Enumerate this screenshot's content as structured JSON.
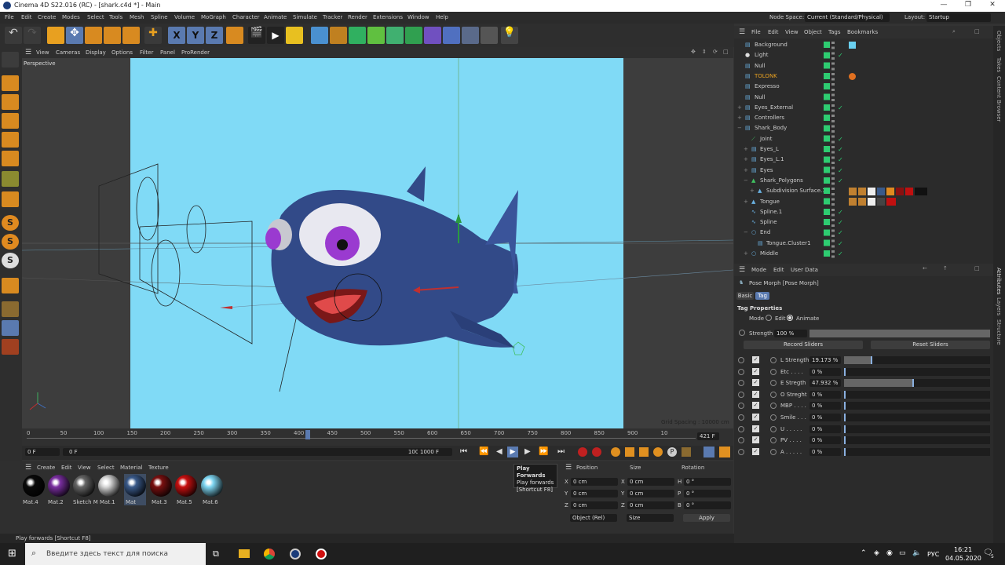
{
  "window": {
    "title": "Cinema 4D S22.016 (RC) - [shark.c4d *] - Main"
  },
  "menubar": {
    "items": [
      "File",
      "Edit",
      "Create",
      "Modes",
      "Select",
      "Tools",
      "Mesh",
      "Spline",
      "Volume",
      "MoGraph",
      "Character",
      "Animate",
      "Simulate",
      "Tracker",
      "Render",
      "Extensions",
      "Window",
      "Help"
    ],
    "node_space_label": "Node Space:",
    "node_space_value": "Current (Standard/Physical)",
    "layout_label": "Layout:",
    "layout_value": "Startup"
  },
  "viewport": {
    "menu": [
      "View",
      "Cameras",
      "Display",
      "Options",
      "Filter",
      "Panel",
      "ProRender"
    ],
    "name": "Perspective",
    "grid_spacing": "Grid Spacing : 10000 cm"
  },
  "timeline": {
    "ticks": [
      "0",
      "50",
      "100",
      "150",
      "200",
      "250",
      "300",
      "350",
      "400",
      "450",
      "500",
      "550",
      "600",
      "650",
      "700",
      "750",
      "800",
      "850",
      "900",
      "10"
    ],
    "current_frame_end": "421 F",
    "start": "0 F",
    "start2": "0 F",
    "end": "1000 F",
    "end2": "1000 F"
  },
  "tooltip": {
    "title": "Play Forwards",
    "line1": "Play forwards",
    "line2": "[Shortcut F8]"
  },
  "materials": {
    "menu": [
      "Create",
      "Edit",
      "View",
      "Select",
      "Material",
      "Texture"
    ],
    "items": [
      {
        "name": "Mat.4",
        "color": "#0a0a0a"
      },
      {
        "name": "Mat.2",
        "color": "#7a2fa0"
      },
      {
        "name": "Sketch M",
        "color": "#666666"
      },
      {
        "name": "Mat.1",
        "color": "#d8d8d8"
      },
      {
        "name": "Mat",
        "color": "#3a5a8a"
      },
      {
        "name": "Mat.3",
        "color": "#7a1010"
      },
      {
        "name": "Mat.5",
        "color": "#c81010"
      },
      {
        "name": "Mat.6",
        "color": "#7fd6f2"
      }
    ]
  },
  "coords": {
    "headers": [
      "Position",
      "Size",
      "Rotation"
    ],
    "rows": [
      {
        "axis": "X",
        "pos": "0 cm",
        "size_axis": "X",
        "size": "0 cm",
        "rot_axis": "H",
        "rot": "0 °"
      },
      {
        "axis": "Y",
        "pos": "0 cm",
        "size_axis": "Y",
        "size": "0 cm",
        "rot_axis": "P",
        "rot": "0 °"
      },
      {
        "axis": "Z",
        "pos": "0 cm",
        "size_axis": "Z",
        "size": "0 cm",
        "rot_axis": "B",
        "rot": "0 °"
      }
    ],
    "mode": "Object (Rel)",
    "size_mode": "Size",
    "apply": "Apply"
  },
  "status": "Play forwards [Shortcut F8]",
  "objmgr": {
    "menu": [
      "File",
      "Edit",
      "View",
      "Object",
      "Tags",
      "Bookmarks"
    ],
    "objects": [
      {
        "name": "Background",
        "indent": 0
      },
      {
        "name": "Light",
        "indent": 0
      },
      {
        "name": "Null",
        "indent": 0
      },
      {
        "name": "TOLONK",
        "indent": 0,
        "orange": true
      },
      {
        "name": "Expresso",
        "indent": 0
      },
      {
        "name": "Null",
        "indent": 0
      },
      {
        "name": "Eyes_External",
        "indent": 0
      },
      {
        "name": "Controllers",
        "indent": 0
      },
      {
        "name": "Shark_Body",
        "indent": 0
      },
      {
        "name": "Joint",
        "indent": 1
      },
      {
        "name": "Eyes_L",
        "indent": 1
      },
      {
        "name": "Eyes_L.1",
        "indent": 1
      },
      {
        "name": "Eyes",
        "indent": 1
      },
      {
        "name": "Shark_Polygons",
        "indent": 1
      },
      {
        "name": "Subdivision Surface.1",
        "indent": 2
      },
      {
        "name": "Tongue",
        "indent": 1
      },
      {
        "name": "Spline.1",
        "indent": 1
      },
      {
        "name": "Spline",
        "indent": 1
      },
      {
        "name": "End",
        "indent": 1
      },
      {
        "name": "Tongue.Cluster1",
        "indent": 2
      },
      {
        "name": "Middle",
        "indent": 1
      }
    ]
  },
  "attrmgr": {
    "menu": [
      "Mode",
      "Edit",
      "User Data"
    ],
    "title": "Pose Morph [Pose Morph]",
    "tabs": [
      "Basic",
      "Tag"
    ],
    "section": "Tag Properties",
    "mode_label": "Mode",
    "mode_edit": "Edit",
    "mode_animate": "Animate",
    "strength_label": "Strength",
    "strength_value": "100 %",
    "strength_fill": 1.0,
    "record": "Record Sliders",
    "reset": "Reset Sliders",
    "sliders": [
      {
        "name": "L Strength",
        "value": "19.173 %",
        "fraction": 0.19173
      },
      {
        "name": "Etc . . . .",
        "value": "0 %",
        "fraction": 0
      },
      {
        "name": "E Stregth",
        "value": "47.932 %",
        "fraction": 0.47932
      },
      {
        "name": "O Streght",
        "value": "0 %",
        "fraction": 0
      },
      {
        "name": "MBP . . . .",
        "value": "0 %",
        "fraction": 0
      },
      {
        "name": "Smile . . .",
        "value": "0 %",
        "fraction": 0
      },
      {
        "name": "U . . . . .",
        "value": "0 %",
        "fraction": 0
      },
      {
        "name": "PV . . . .",
        "value": "0 %",
        "fraction": 0
      },
      {
        "name": "A . . . . .",
        "value": "0 %",
        "fraction": 0
      }
    ]
  },
  "sidetabs": [
    "Objects",
    "Takes",
    "Content Browser",
    "Attributes",
    "Layers",
    "Structure"
  ],
  "taskbar": {
    "search_placeholder": "Введите здесь текст для поиска",
    "lang": "РУС",
    "time": "16:21",
    "date": "04.05.2020",
    "notif": "5"
  }
}
